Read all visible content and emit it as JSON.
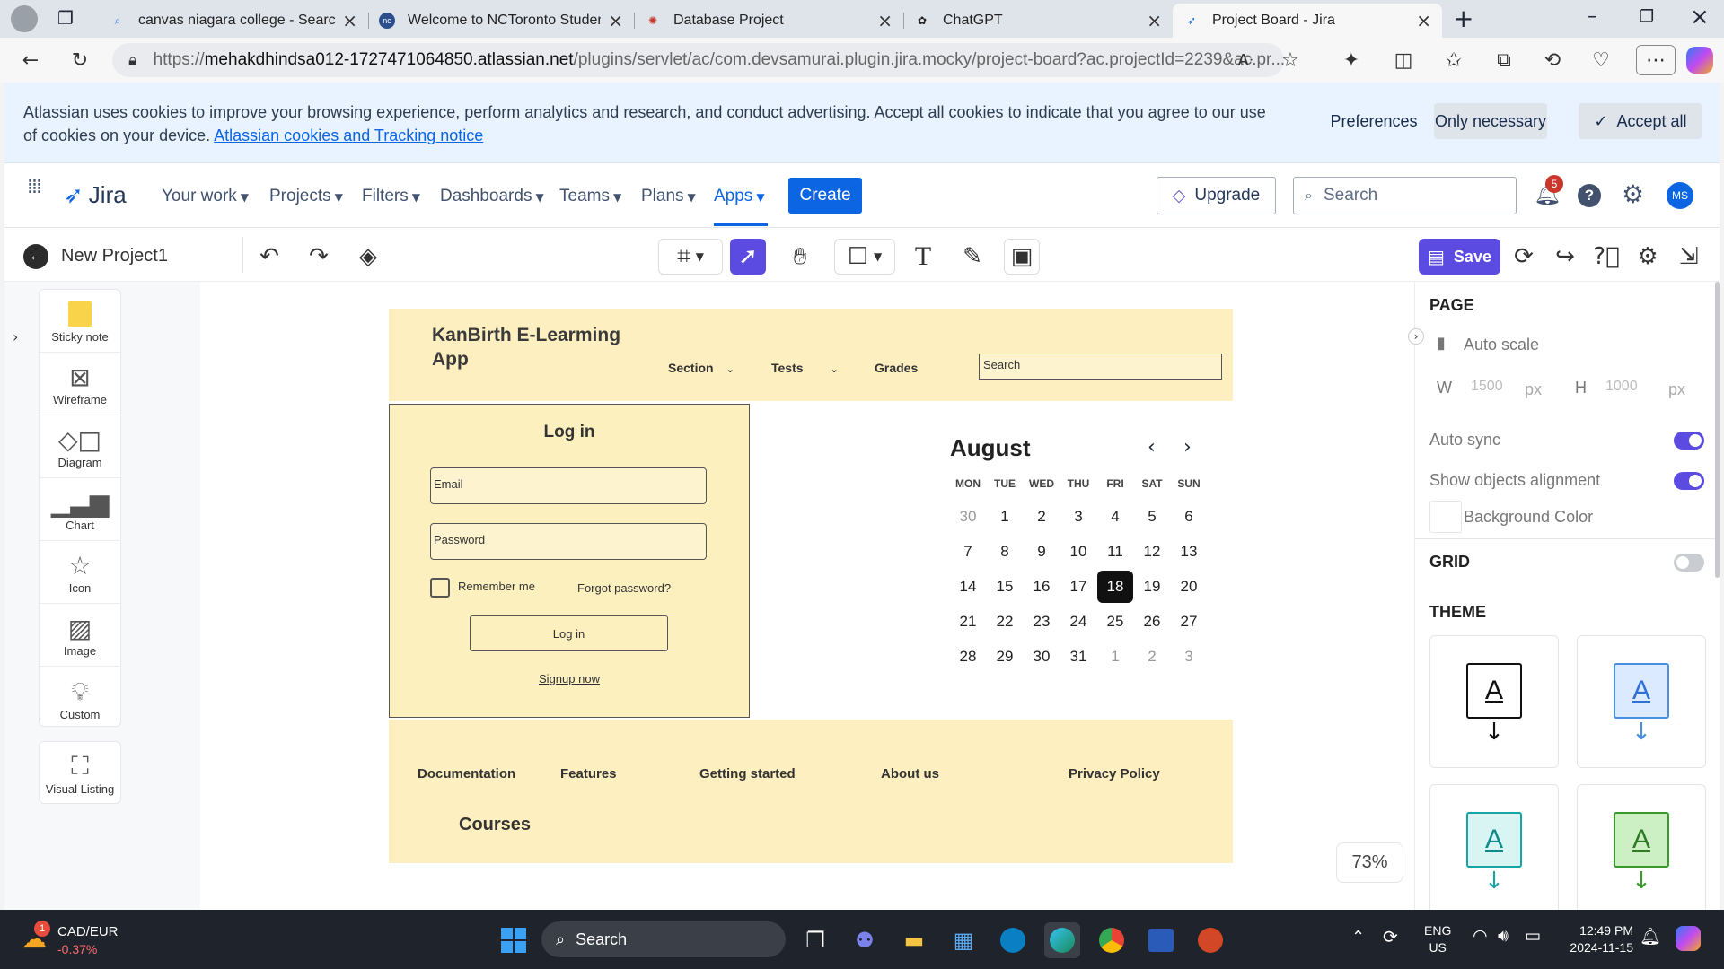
{
  "browser": {
    "tabs": [
      {
        "title": "canvas niagara college - Search",
        "icon": "search-favicon"
      },
      {
        "title": "Welcome to NCToronto Student P",
        "icon": "nc-favicon"
      },
      {
        "title": "Database Project",
        "icon": "database-favicon"
      },
      {
        "title": "ChatGPT",
        "icon": "chatgpt-favicon"
      },
      {
        "title": "Project Board - Jira",
        "icon": "jira-favicon",
        "active": true
      }
    ],
    "url_prefix": "https://",
    "url_domain": "mehakdhindsa012-1727471064850.atlassian.net",
    "url_path": "/plugins/servlet/ac/com.devsamurai.plugin.jira.mocky/project-board?ac.projectId=2239&ac.pr..."
  },
  "cookie_banner": {
    "text": "Atlassian uses cookies to improve your browsing experience, perform analytics and research, and conduct advertising. Accept all cookies to indicate that you agree to our use of cookies on your device.",
    "link": "Atlassian cookies and Tracking notice",
    "preferences": "Preferences",
    "only_necessary": "Only necessary",
    "accept_all": "Accept all"
  },
  "jira_nav": {
    "logo": "Jira",
    "items": [
      "Your work",
      "Projects",
      "Filters",
      "Dashboards",
      "Teams",
      "Plans",
      "Apps"
    ],
    "active": "Apps",
    "create": "Create",
    "upgrade": "Upgrade",
    "search_placeholder": "Search",
    "notifications": "5",
    "avatar": "MS",
    "accent": "#0c66e4"
  },
  "editor": {
    "project_name": "New Project1",
    "save": "Save",
    "accent": "#5b4be0"
  },
  "palette": [
    "Sticky note",
    "Wireframe",
    "Diagram",
    "Chart",
    "Icon",
    "Image",
    "Custom",
    "Visual Listing"
  ],
  "wireframe": {
    "title": "KanBirth E-Learming App",
    "nav": [
      "Section",
      "Tests",
      "Grades"
    ],
    "search": "Search",
    "login_title": "Log in",
    "email": "Email",
    "password": "Password",
    "remember": "Remember me",
    "forgot": "Forgot password?",
    "login_button": "Log in",
    "signup": "Signup now",
    "footer_links": [
      "Documentation",
      "Features",
      "Getting started",
      "About us",
      "Privacy Policy"
    ],
    "courses": "Courses",
    "fill_color": "#fdefbf"
  },
  "calendar": {
    "month": "August",
    "days": [
      "MON",
      "TUE",
      "WED",
      "THU",
      "FRI",
      "SAT",
      "SUN"
    ],
    "weeks": [
      [
        "30",
        "1",
        "2",
        "3",
        "4",
        "5",
        "6"
      ],
      [
        "7",
        "8",
        "9",
        "10",
        "11",
        "12",
        "13"
      ],
      [
        "14",
        "15",
        "16",
        "17",
        "18",
        "19",
        "20"
      ],
      [
        "21",
        "22",
        "23",
        "24",
        "25",
        "26",
        "27"
      ],
      [
        "28",
        "29",
        "30",
        "31",
        "1",
        "2",
        "3"
      ]
    ],
    "selected": "18"
  },
  "zoom": "73%",
  "right_panel": {
    "page": "PAGE",
    "auto_scale": "Auto scale",
    "w_label": "W",
    "w_value": "1500",
    "h_label": "H",
    "h_value": "1000",
    "unit": "px",
    "auto_sync": "Auto sync",
    "show_alignment": "Show objects alignment",
    "background_color": "Background Color",
    "grid": "GRID",
    "theme": "THEME",
    "theme_letter": "A"
  },
  "taskbar": {
    "ticker": "CAD/EUR",
    "ticker_change": "-0.37%",
    "ticker_badge": "1",
    "search": "Search",
    "lang": "ENG",
    "region": "US",
    "time": "12:49 PM",
    "date": "2024-11-15"
  }
}
